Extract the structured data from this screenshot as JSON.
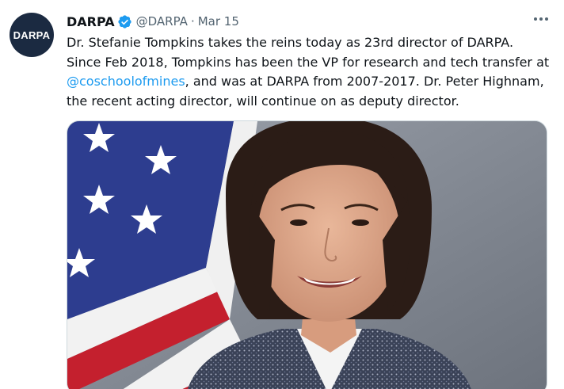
{
  "tweet": {
    "avatar_text": "DARPA",
    "display_name": "DARPA",
    "verified_icon": "verified-badge-icon",
    "handle": "@DARPA",
    "separator": "·",
    "date": "Mar 15",
    "more_icon": "more-options-icon",
    "text_part1": "Dr. Stefanie Tompkins takes the reins today as 23rd director of DARPA. Since Feb 2018, Tompkins has been the VP for research and tech transfer at ",
    "mention": "@coschoolofmines",
    "text_part2": ", and was at DARPA from 2007-2017. Dr. Peter Highnam, the recent acting director, will continue on as deputy director.",
    "colors": {
      "accent": "#1d9bf0",
      "text": "#0f1419",
      "secondary": "#536471",
      "avatar_bg": "#1b2a41"
    }
  }
}
